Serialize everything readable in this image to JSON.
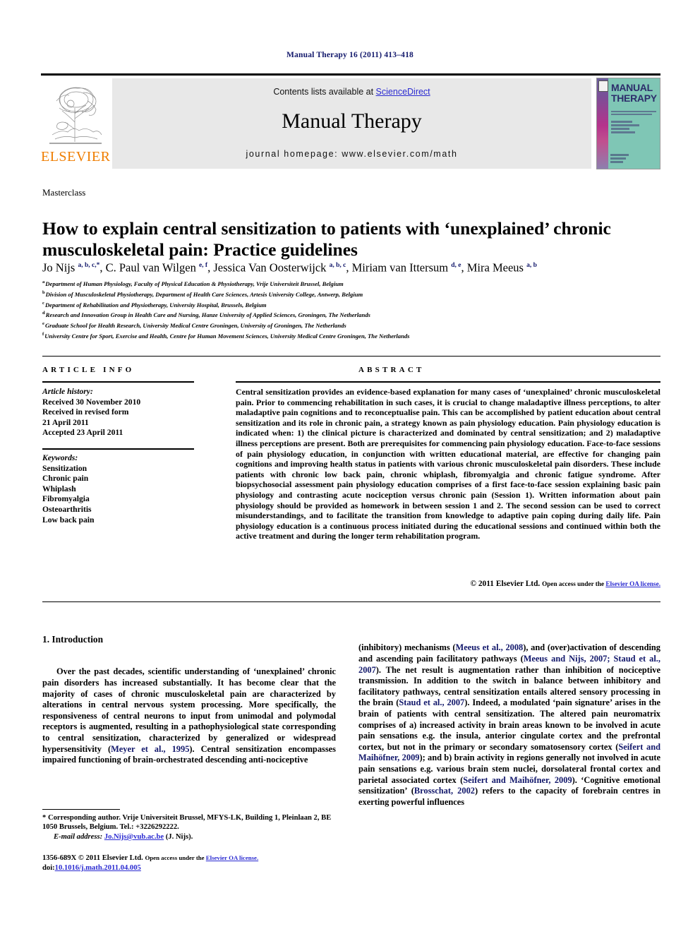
{
  "running_head": "Manual Therapy 16 (2011) 413–418",
  "masthead": {
    "contents_prefix": "Contents lists available at ",
    "sciencedirect": "ScienceDirect",
    "journal_title": "Manual Therapy",
    "homepage": "journal homepage: www.elsevier.com/math",
    "publisher_name": "ELSEVIER",
    "cover": {
      "title_line1": "MANUAL",
      "title_line2": "THERAPY"
    }
  },
  "article": {
    "type_label": "Masterclass",
    "title": "How to explain central sensitization to patients with ‘unexplained’ chronic musculoskeletal pain: Practice guidelines",
    "authors_html": "Jo Nijs <sup>a, b, c,</sup><sup>*</sup>, C. Paul van Wilgen <sup>e, f</sup>, Jessica Van Oosterwijck <sup>a, b, c</sup>, Miriam van Ittersum <sup>d, e</sup>, Mira Meeus <sup>a, b</sup>",
    "affiliations": [
      {
        "marker": "a",
        "text": "Department of Human Physiology, Faculty of Physical Education & Physiotherapy, Vrije Universiteit Brussel, Belgium"
      },
      {
        "marker": "b",
        "text": "Division of Musculoskeletal Physiotherapy, Department of Health Care Sciences, Artesis University College, Antwerp, Belgium"
      },
      {
        "marker": "c",
        "text": "Department of Rehabilitation and Physiotherapy, University Hospital, Brussels, Belgium"
      },
      {
        "marker": "d",
        "text": "Research and Innovation Group in Health Care and Nursing, Hanze University of Applied Sciences, Groningen, The Netherlands"
      },
      {
        "marker": "e",
        "text": "Graduate School for Health Research, University Medical Centre Groningen, University of Groningen, The Netherlands"
      },
      {
        "marker": "f",
        "text": "University Centre for Sport, Exercise and Health, Centre for Human Movement Sciences, University Medical Centre Groningen, The Netherlands"
      }
    ]
  },
  "article_info": {
    "heading": "ARTICLE INFO",
    "history_label": "Article history:",
    "history": [
      "Received 30 November 2010",
      "Received in revised form",
      "21 April 2011",
      "Accepted 23 April 2011"
    ],
    "keywords_label": "Keywords:",
    "keywords": [
      "Sensitization",
      "Chronic pain",
      "Whiplash",
      "Fibromyalgia",
      "Osteoarthritis",
      "Low back pain"
    ]
  },
  "abstract": {
    "heading": "ABSTRACT",
    "text": "Central sensitization provides an evidence-based explanation for many cases of ‘unexplained’ chronic musculoskeletal pain. Prior to commencing rehabilitation in such cases, it is crucial to change maladaptive illness perceptions, to alter maladaptive pain cognitions and to reconceptualise pain. This can be accomplished by patient education about central sensitization and its role in chronic pain, a strategy known as pain physiology education. Pain physiology education is indicated when: 1) the clinical picture is characterized and dominated by central sensitization; and 2) maladaptive illness perceptions are present. Both are prerequisites for commencing pain physiology education. Face-to-face sessions of pain physiology education, in conjunction with written educational material, are effective for changing pain cognitions and improving health status in patients with various chronic musculoskeletal pain disorders. These include patients with chronic low back pain, chronic whiplash, fibromyalgia and chronic fatigue syndrome. After biopsychosocial assessment pain physiology education comprises of a first face-to-face session explaining basic pain physiology and contrasting acute nociception versus chronic pain (Session 1). Written information about pain physiology should be provided as homework in between session 1 and 2. The second session can be used to correct misunderstandings, and to facilitate the transition from knowledge to adaptive pain coping during daily life. Pain physiology education is a continuous process initiated during the educational sessions and continued within both the active treatment and during the longer term rehabilitation program.",
    "copyright": "© 2011 Elsevier Ltd.",
    "open_access": "Open access under the ",
    "license_link": "Elsevier OA license."
  },
  "body": {
    "section_number_title": "1. Introduction",
    "left_column_html": "<p class=\"indent\">Over the past decades, scientific understanding of ‘unexplained’ chronic pain disorders has increased substantially. It has become clear that the majority of cases of chronic musculoskeletal pain are characterized by alterations in central nervous system processing. More specifically, the responsiveness of central neurons to input from unimodal and polymodal receptors is augmented, resulting in a pathophysiological state corresponding to central sensitization, characterized by generalized or widespread hypersensitivity (<span class=\"cite\">Meyer et al., 1995</span>). Central sensitization encompasses impaired functioning of brain-orchestrated descending anti-nociceptive</p>",
    "right_column_html": "<p>(inhibitory) mechanisms (<span class=\"cite\">Meeus et al., 2008</span>), and (over)activation of descending and ascending pain facilitatory pathways (<span class=\"cite\">Meeus and Nijs, 2007; Staud et al., 2007</span>). The net result is augmentation rather than inhibition of nociceptive transmission. In addition to the switch in balance between inhibitory and facilitatory pathways, central sensitization entails altered sensory processing in the brain (<span class=\"cite\">Staud et al., 2007</span>). Indeed, a modulated ‘pain signature’ arises in the brain of patients with central sensitization. The altered pain neuromatrix comprises of a) increased activity in brain areas known to be involved in acute pain sensations e.g. the insula, anterior cingulate cortex and the prefrontal cortex, but not in the primary or secondary somatosensory cortex (<span class=\"cite\">Seifert and Maihöfner, 2009</span>); and b) brain activity in regions generally not involved in acute pain sensations e.g. various brain stem nuclei, dorsolateral frontal cortex and parietal associated cortex (<span class=\"cite\">Seifert and Maihöfner, 2009</span>). ‘Cognitive emotional sensitization’ (<span class=\"cite\">Brosschat, 2002</span>) refers to the capacity of forebrain centres in exerting powerful influences</p>"
  },
  "footnote": {
    "corresponding_html": "* Corresponding author. Vrije Universiteit Brussel, MFYS-LK, Building 1, Pleinlaan 2, BE 1050 Brussels, Belgium. Tel.: +3226292222.",
    "email_label": "E-mail address:",
    "email": "Jo.Nijs@vub.ac.be",
    "email_owner": "(J. Nijs)."
  },
  "imprint": {
    "issn_line_prefix": "1356-689X © 2011 Elsevier Ltd. ",
    "open_access": "Open access under the ",
    "license_link": "Elsevier OA license.",
    "doi": "doi:10.1016/j.math.2011.04.005"
  },
  "colors": {
    "link_blue": "#2a2ad1",
    "citation_navy": "#12186b",
    "elsevier_orange": "#ef7d00",
    "banner_grey": "#e8e8e8",
    "cover_teal": "#7fc6b5"
  }
}
